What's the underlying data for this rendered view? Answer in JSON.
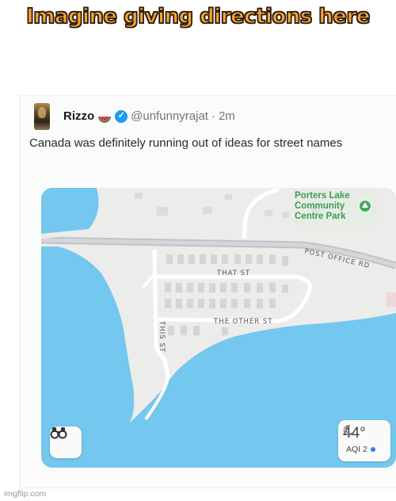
{
  "meme": {
    "caption": "Imagine giving directions here",
    "watermark": "imgflip.com"
  },
  "tweet": {
    "display_name": "Rizzo",
    "name_emoji": "watermelon-emoji",
    "verified": true,
    "handle": "@unfunnyrajat",
    "separator": "·",
    "time": "2m",
    "text": "Canada was definitely running out of ideas for street names"
  },
  "map": {
    "park_label_lines": [
      "Porters Lake",
      "Community",
      "Centre Park"
    ],
    "streets": {
      "post_office": "POST OFFICE RD",
      "that": "THAT ST",
      "the_other": "THE OTHER ST",
      "this": "THIS ST"
    },
    "weather": {
      "temperature": "44°",
      "aqi": "AQI 2"
    },
    "colors": {
      "water": "#74c7ef",
      "land": "#ececea",
      "road": "#ffffff",
      "building": "#d9d9d9",
      "park_green": "#3d9c55",
      "aqi_dot": "#2d7de0"
    }
  }
}
